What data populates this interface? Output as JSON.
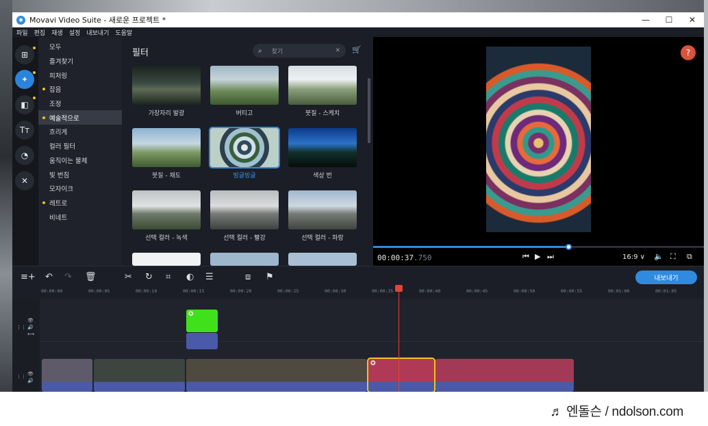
{
  "window": {
    "title": "Movavi Video Suite - 새로운 프로젝트 *"
  },
  "menu": [
    "파일",
    "편집",
    "재생",
    "설정",
    "내보내기",
    "도움말"
  ],
  "categories": [
    {
      "label": "모두",
      "dot": false,
      "selected": false
    },
    {
      "label": "즐겨찾기",
      "dot": false,
      "selected": false
    },
    {
      "label": "피처링",
      "dot": false,
      "selected": false
    },
    {
      "label": "잡음",
      "dot": true,
      "selected": false
    },
    {
      "label": "조정",
      "dot": false,
      "selected": false
    },
    {
      "label": "예술적으로",
      "dot": true,
      "selected": true
    },
    {
      "label": "흐리게",
      "dot": false,
      "selected": false
    },
    {
      "label": "컬러 필터",
      "dot": false,
      "selected": false
    },
    {
      "label": "움직이는 물체",
      "dot": false,
      "selected": false
    },
    {
      "label": "빛 번짐",
      "dot": false,
      "selected": false
    },
    {
      "label": "모자이크",
      "dot": false,
      "selected": false
    },
    {
      "label": "레트로",
      "dot": true,
      "selected": false
    },
    {
      "label": "비네트",
      "dot": false,
      "selected": false
    }
  ],
  "filters_panel": {
    "title": "필터",
    "search_placeholder": "찾기",
    "items": [
      {
        "label": "가장자리 발광",
        "selected": false
      },
      {
        "label": "버티고",
        "selected": false
      },
      {
        "label": "붓질 - 스케치",
        "selected": false
      },
      {
        "label": "붓질 - 채도",
        "selected": false
      },
      {
        "label": "빙글빙글",
        "selected": true
      },
      {
        "label": "색상 번",
        "selected": false
      },
      {
        "label": "선택 컬러 - 녹색",
        "selected": false
      },
      {
        "label": "선택 컬러 - 빨강",
        "selected": false
      },
      {
        "label": "선택 컬러 - 파랑",
        "selected": false
      },
      {
        "label": "",
        "selected": false
      },
      {
        "label": "",
        "selected": false
      },
      {
        "label": "",
        "selected": false
      }
    ]
  },
  "player": {
    "help_label": "?",
    "time_main": "00:00:37",
    "time_ms": ".750",
    "progress": 0.59,
    "aspect": "16:9 ∨"
  },
  "toolbar": {
    "export_label": "내보내기"
  },
  "ruler": [
    "00:00:00",
    "00:00:05",
    "00:00:10",
    "00:00:15",
    "00:00:20",
    "00:00:25",
    "00:00:30",
    "00:00:35",
    "00:00:40",
    "00:00:45",
    "00:00:50",
    "00:00:55",
    "00:01:00",
    "00:01:05"
  ],
  "watermark": "♬ 엔돌슨 / ndolson.com",
  "colors": {
    "accent": "#2f8ae0",
    "playhead": "#e0443a",
    "selected_clip": "#f0c419",
    "green_clip": "#3fe21a"
  }
}
